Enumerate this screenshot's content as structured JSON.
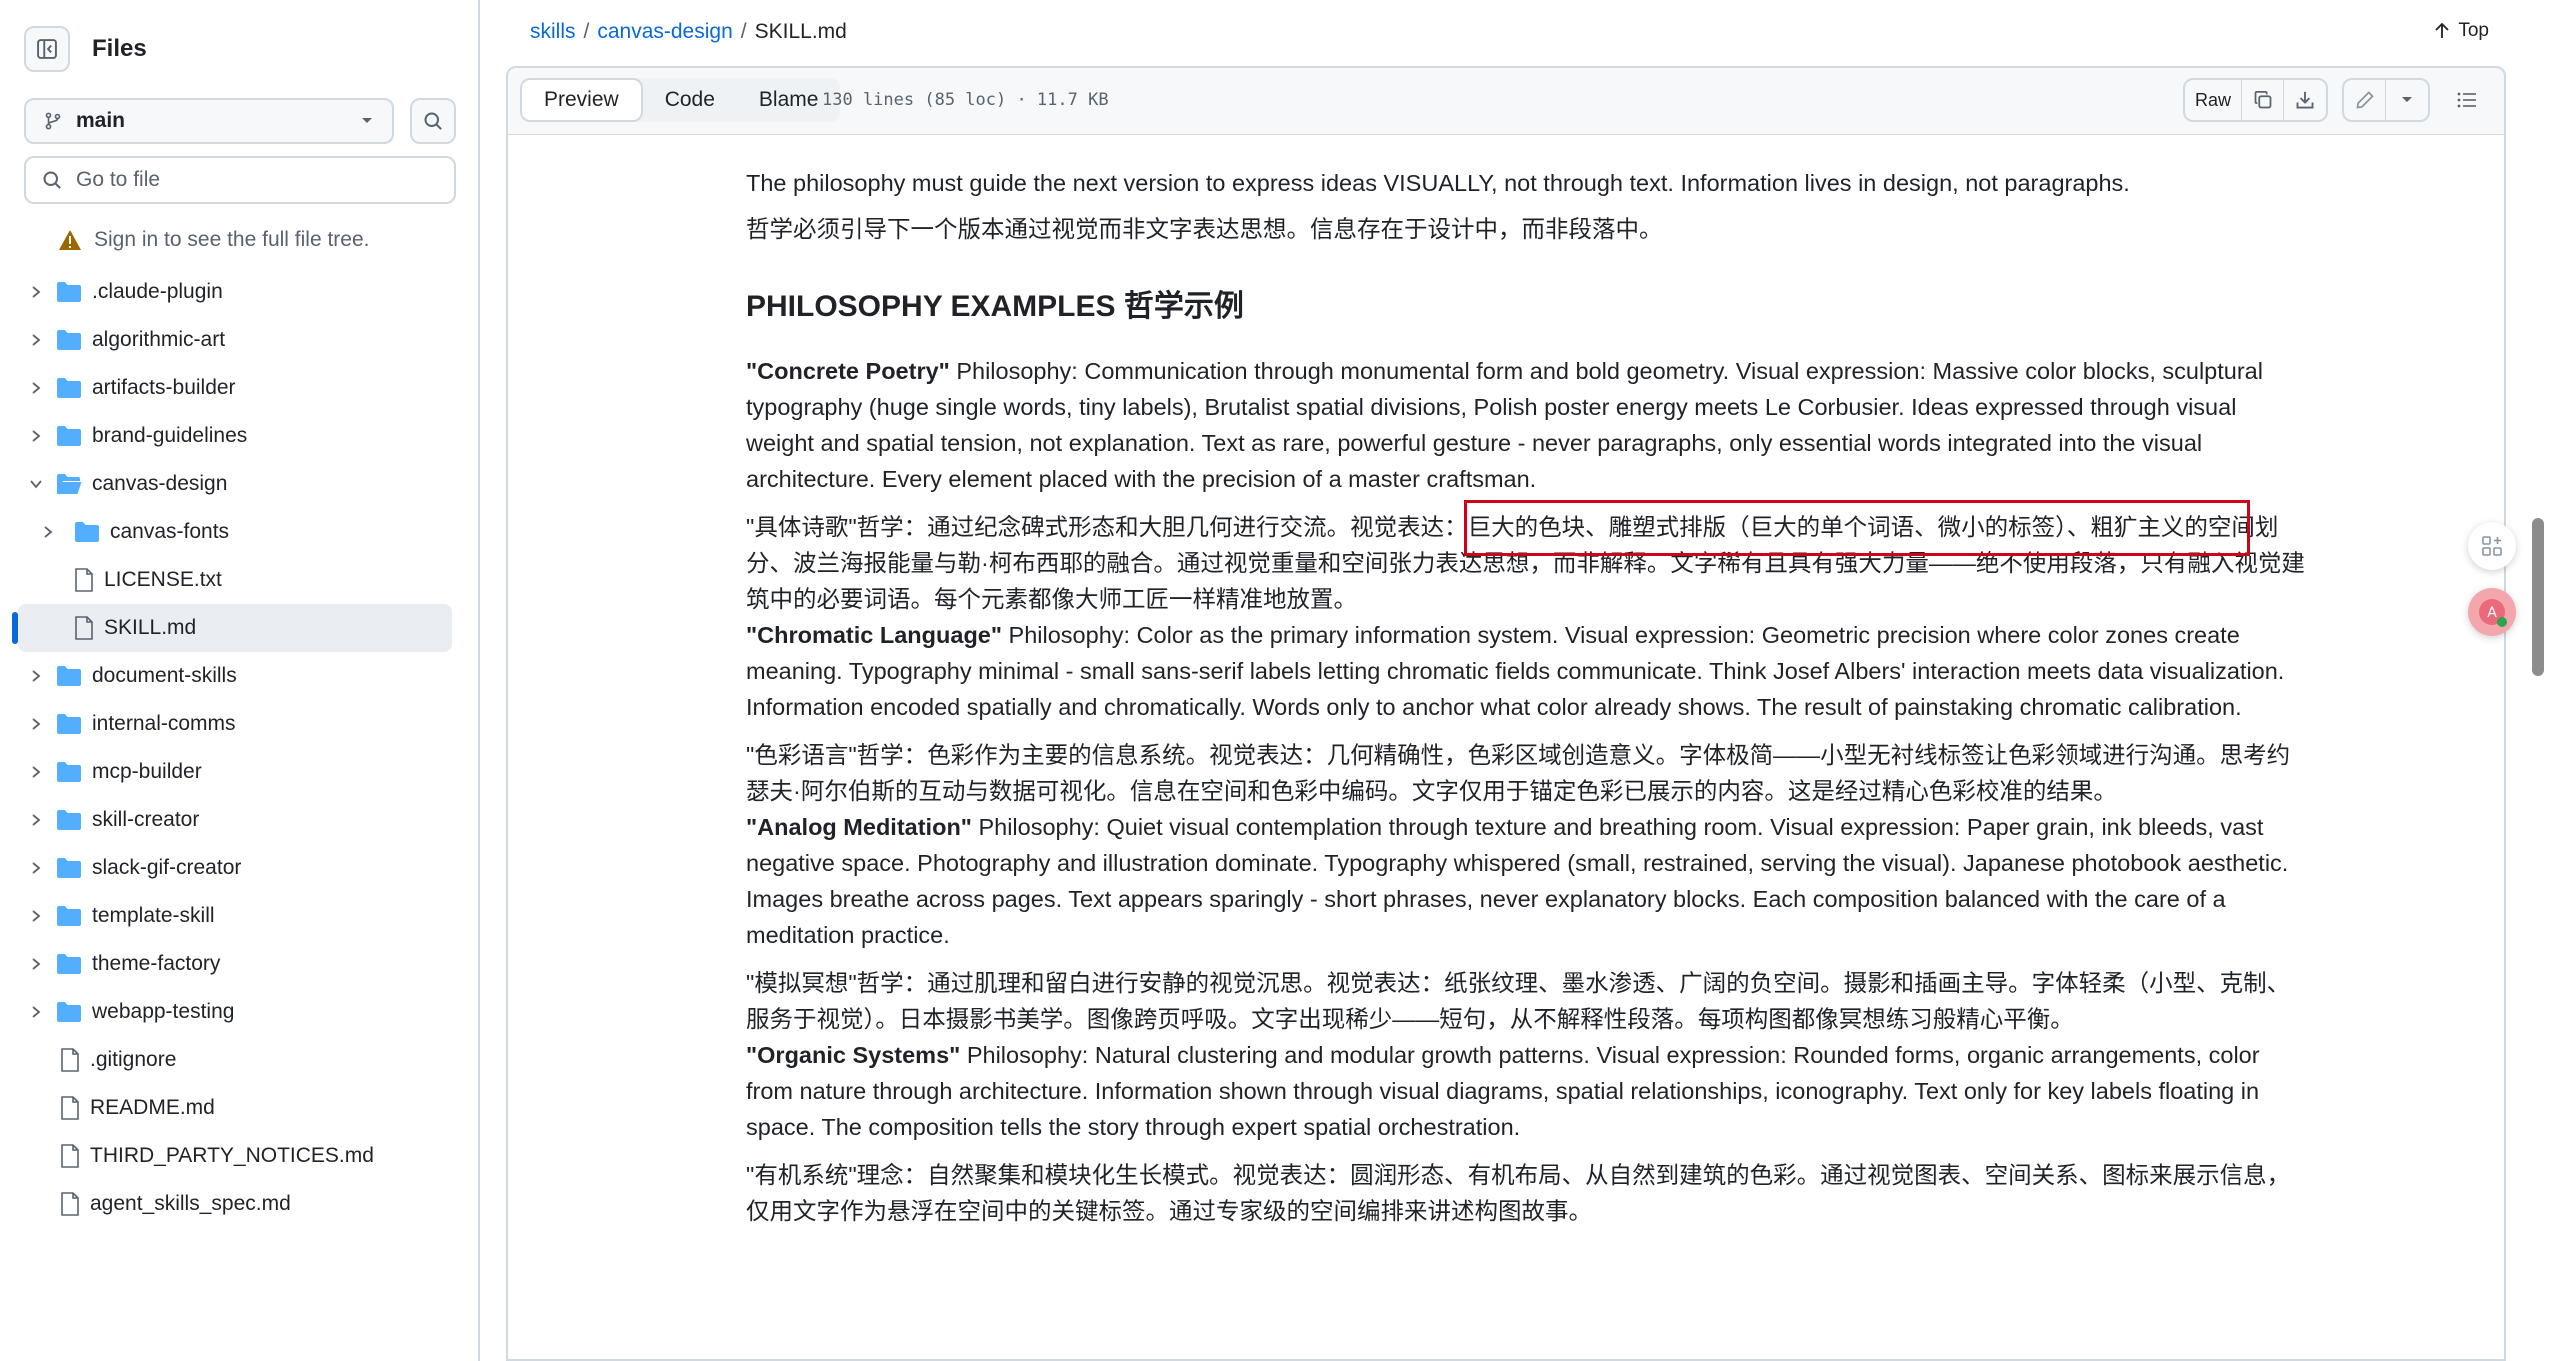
{
  "sidebar": {
    "title": "Files",
    "branch": "main",
    "goto_placeholder": "Go to file",
    "signin_notice": "Sign in to see the full file tree.",
    "items": [
      {
        "label": ".claude-plugin"
      },
      {
        "label": "algorithmic-art"
      },
      {
        "label": "artifacts-builder"
      },
      {
        "label": "brand-guidelines"
      },
      {
        "label": "canvas-design"
      },
      {
        "label": "canvas-fonts"
      },
      {
        "label": "LICENSE.txt"
      },
      {
        "label": "SKILL.md"
      },
      {
        "label": "document-skills"
      },
      {
        "label": "internal-comms"
      },
      {
        "label": "mcp-builder"
      },
      {
        "label": "skill-creator"
      },
      {
        "label": "slack-gif-creator"
      },
      {
        "label": "template-skill"
      },
      {
        "label": "theme-factory"
      },
      {
        "label": "webapp-testing"
      },
      {
        "label": ".gitignore"
      },
      {
        "label": "README.md"
      },
      {
        "label": "THIRD_PARTY_NOTICES.md"
      },
      {
        "label": "agent_skills_spec.md"
      }
    ]
  },
  "breadcrumb": {
    "root": "skills",
    "folder": "canvas-design",
    "file": "SKILL.md",
    "top_label": "Top"
  },
  "toolbar": {
    "tabs": [
      "Preview",
      "Code",
      "Blame"
    ],
    "active_tab": "Preview",
    "meta": "130 lines (85 loc) · 11.7 KB",
    "raw_label": "Raw"
  },
  "article": {
    "intro_en": "The philosophy must guide the next version to express ideas VISUALLY, not through text. Information lives in design, not paragraphs.",
    "intro_zh": "哲学必须引导下一个版本通过视觉而非文字表达思想。信息存在于设计中，而非段落中。",
    "heading": "PHILOSOPHY EXAMPLES  哲学示例",
    "examples": [
      {
        "name": "\"Concrete Poetry\"",
        "en": " Philosophy: Communication through monumental form and bold geometry. Visual expression: Massive color blocks, sculptural typography (huge single words, tiny labels), Brutalist spatial divisions, Polish poster energy meets Le Corbusier. Ideas expressed through visual weight and spatial tension, not explanation. Text as rare, powerful gesture - never paragraphs, only essential words integrated into the visual architecture. Every element placed with the precision of a master craftsman.",
        "zh": "\"具体诗歌\"哲学：通过纪念碑式形态和大胆几何进行交流。视觉表达：巨大的色块、雕塑式排版（巨大的单个词语、微小的标签）、粗犷主义的空间划分、波兰海报能量与勒·柯布西耶的融合。通过视觉重量和空间张力表达思想，而非解释。文字稀有且具有强大力量——绝不使用段落，只有融入视觉建筑中的必要词语。每个元素都像大师工匠一样精准地放置。"
      },
      {
        "name": "\"Chromatic Language\"",
        "en": " Philosophy: Color as the primary information system. Visual expression: Geometric precision where color zones create meaning. Typography minimal - small sans-serif labels letting chromatic fields communicate. Think Josef Albers' interaction meets data visualization. Information encoded spatially and chromatically. Words only to anchor what color already shows. The result of painstaking chromatic calibration.",
        "zh": "\"色彩语言\"哲学：色彩作为主要的信息系统。视觉表达：几何精确性，色彩区域创造意义。字体极简——小型无衬线标签让色彩领域进行沟通。思考约瑟夫·阿尔伯斯的互动与数据可视化。信息在空间和色彩中编码。文字仅用于锚定色彩已展示的内容。这是经过精心色彩校准的结果。"
      },
      {
        "name": "\"Analog Meditation\"",
        "en": " Philosophy: Quiet visual contemplation through texture and breathing room. Visual expression: Paper grain, ink bleeds, vast negative space. Photography and illustration dominate. Typography whispered (small, restrained, serving the visual). Japanese photobook aesthetic. Images breathe across pages. Text appears sparingly - short phrases, never explanatory blocks. Each composition balanced with the care of a meditation practice.",
        "zh": "\"模拟冥想\"哲学：通过肌理和留白进行安静的视觉沉思。视觉表达：纸张纹理、墨水渗透、广阔的负空间。摄影和插画主导。字体轻柔（小型、克制、服务于视觉）。日本摄影书美学。图像跨页呼吸。文字出现稀少——短句，从不解释性段落。每项构图都像冥想练习般精心平衡。"
      },
      {
        "name": "\"Organic Systems\"",
        "en": " Philosophy: Natural clustering and modular growth patterns. Visual expression: Rounded forms, organic arrangements, color from nature through architecture. Information shown through visual diagrams, spatial relationships, iconography. Text only for key labels floating in space. The composition tells the story through expert spatial orchestration.",
        "zh": "\"有机系统\"理念：自然聚集和模块化生长模式。视觉表达：圆润形态、有机布局、从自然到建筑的色彩。通过视觉图表、空间关系、图标来展示信息，仅用文字作为悬浮在空间中的关键标签。通过专家级的空间编排来讲述构图故事。"
      }
    ]
  },
  "colors": {
    "link": "#0969da",
    "border": "#d1d9e0",
    "highlight": "#d0021b",
    "text": "#1f2328"
  }
}
